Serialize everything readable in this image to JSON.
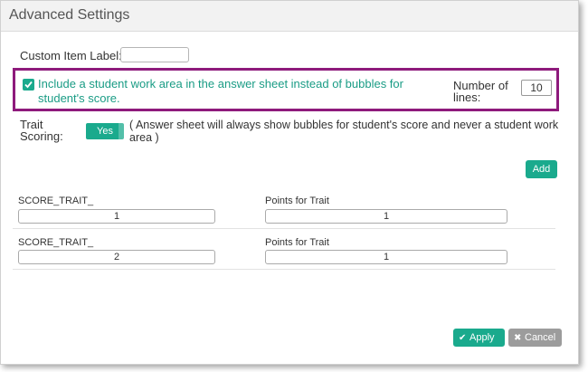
{
  "dialog": {
    "title": "Advanced Settings"
  },
  "custom_label": {
    "label": "Custom Item Label:",
    "value": ""
  },
  "work_area": {
    "checked": true,
    "text": "Include a student work area in the answer sheet instead of bubbles for student's score.",
    "lines_label": "Number of lines:",
    "lines_value": "10"
  },
  "trait_scoring": {
    "label": "Trait Scoring:",
    "toggle_label": "Yes",
    "note": "( Answer sheet will always show bubbles for student's score and never a student work area )"
  },
  "add_label": "Add",
  "traits": [
    {
      "name_label": "SCORE_TRAIT_",
      "name_value": "1",
      "points_label": "Points for Trait",
      "points_value": "1"
    },
    {
      "name_label": "SCORE_TRAIT_",
      "name_value": "2",
      "points_label": "Points for Trait",
      "points_value": "1"
    }
  ],
  "footer": {
    "apply_label": "Apply",
    "cancel_label": "Cancel"
  },
  "colors": {
    "accent": "#1aaa8d",
    "highlight": "#8e1a7c",
    "cancel": "#9c9c9c"
  }
}
